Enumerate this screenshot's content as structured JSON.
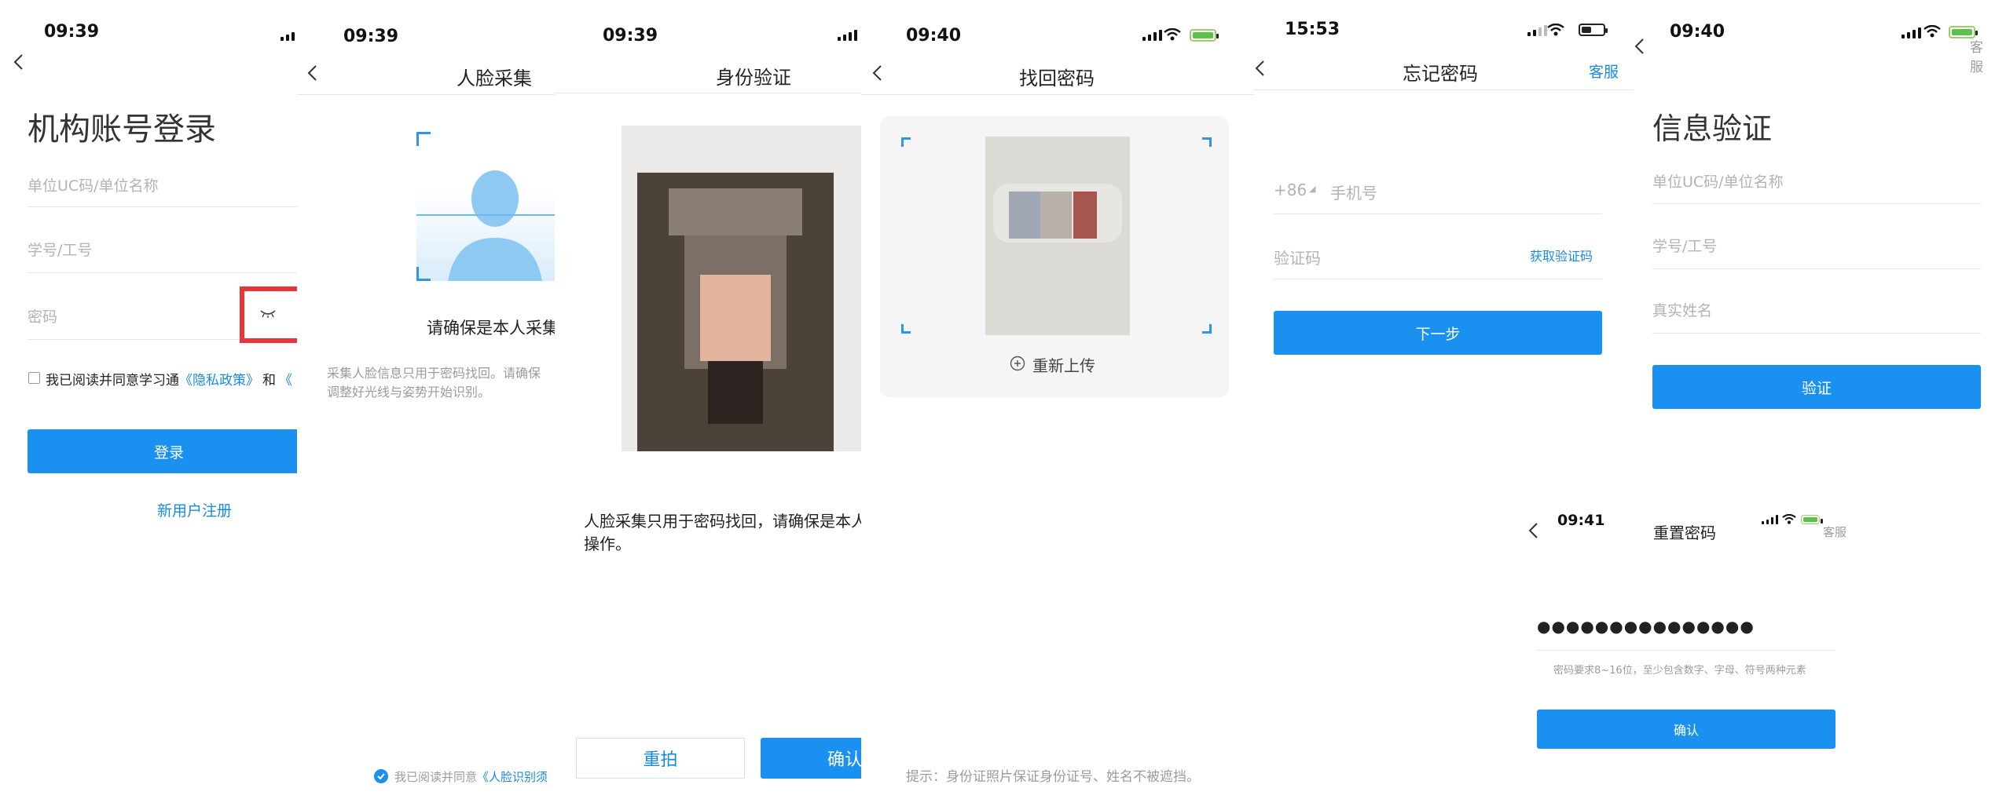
{
  "colors": {
    "accent": "#1a90f0",
    "link": "#1a8ae0",
    "highlight": "#e8343a"
  },
  "p1": {
    "time": "09:39",
    "heading": "机构账号登录",
    "unit_placeholder": "单位UC码/单位名称",
    "id_placeholder": "学号/工号",
    "pwd_placeholder": "密码",
    "agree_prefix": "我已阅读并同意学习通",
    "privacy_link": "《隐私政策》",
    "and": "和",
    "more_link": "《",
    "login": "登录",
    "register": "新用户注册",
    "eye_icon": "eye-closed-icon"
  },
  "p2": {
    "time": "09:39",
    "title": "人脸采集",
    "ensure": "请确保是本人采集",
    "desc1": "采集人脸信息只用于密码找回。请确保",
    "desc2": "调整好光线与姿势开始识别。",
    "agree_prefix": "我已阅读并同意",
    "agree_link": "《人脸识别须"
  },
  "p3": {
    "time": "09:39",
    "title": "身份验证",
    "note1": "人脸采集只用于密码找回，请确保是本人",
    "note2": "操作。",
    "retake": "重拍",
    "confirm": "确认"
  },
  "p4": {
    "time": "09:40",
    "title": "找回密码",
    "reupload": "重新上传",
    "tip": "提示：身份证照片保证身份证号、姓名不被遮挡。"
  },
  "p5": {
    "time": "15:53",
    "title": "忘记密码",
    "service": "客服",
    "code": "+86",
    "phone_placeholder": "手机号",
    "verify_placeholder": "验证码",
    "get_code": "获取验证码",
    "next": "下一步"
  },
  "p6": {
    "time": "09:40",
    "service": "客服",
    "heading": "信息验证",
    "unit_placeholder": "单位UC码/单位名称",
    "id_placeholder": "学号/工号",
    "name_placeholder": "真实姓名",
    "verify": "验证"
  },
  "p7": {
    "time": "09:41",
    "title": "重置密码",
    "service": "客服",
    "password": "●●●●●●●●●●●●●●●",
    "requirement": "密码要求8~16位，至少包含数字、字母、符号两种元素",
    "confirm": "确认"
  }
}
